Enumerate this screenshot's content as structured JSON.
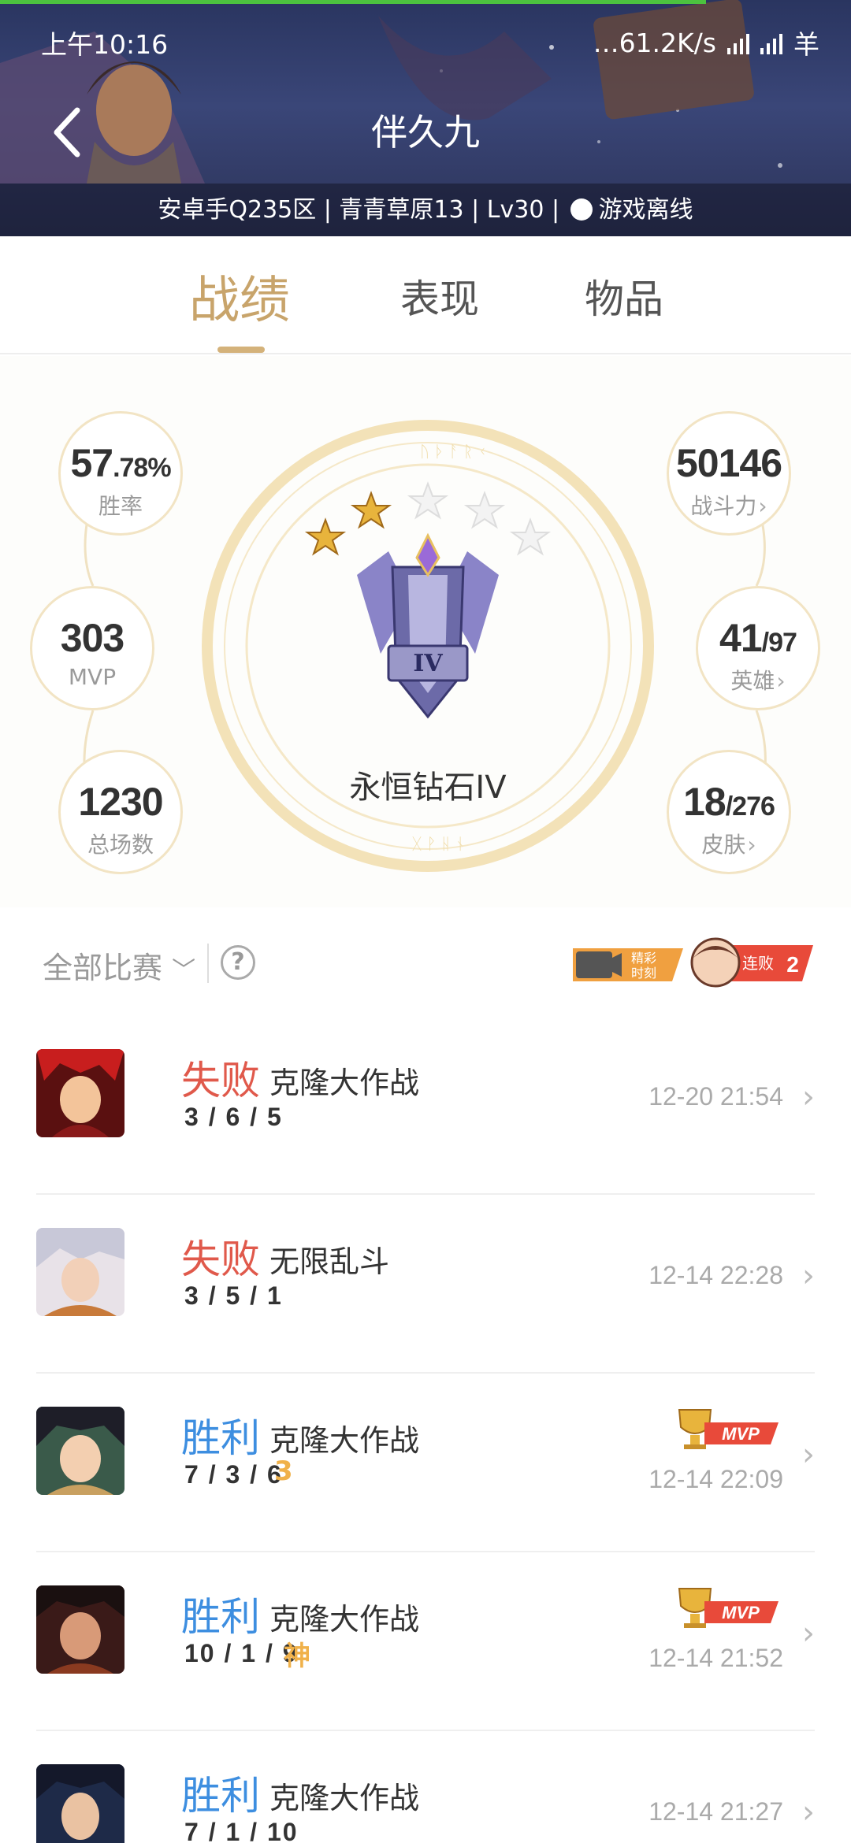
{
  "status_bar": {
    "time": "上午10:16",
    "net_speed": "61.2K/s",
    "extra_icon": "羊"
  },
  "header": {
    "title": "伴久九",
    "subtitle_prefix": "安卓手Q235区 | 青青草原13 | Lv30 |",
    "subtitle_status": "游戏离线",
    "back_icon": "chevron-left-icon"
  },
  "tabs": [
    {
      "label": "战绩",
      "active": true
    },
    {
      "label": "表现",
      "active": false
    },
    {
      "label": "物品",
      "active": false
    }
  ],
  "stats": {
    "win_rate_main": "57",
    "win_rate_frac": ".78%",
    "win_rate_label": "胜率",
    "mvp": "303",
    "mvp_label": "MVP",
    "total_matches": "1230",
    "total_matches_label": "总场数",
    "power": "50146",
    "power_label": "战斗力",
    "heroes_owned": "41",
    "heroes_total": "/97",
    "heroes_label": "英雄",
    "skins_owned": "18",
    "skins_total": "/276",
    "skins_label": "皮肤"
  },
  "rank": {
    "name": "永恒钻石IV",
    "tier_numeral": "IV",
    "stars_filled": 2,
    "stars_total": 5
  },
  "filter": {
    "selected": "全部比赛",
    "highlight_badge": [
      "精彩",
      "时刻"
    ],
    "streak_label": "连败",
    "streak_count": "2"
  },
  "matches": [
    {
      "result": "失败",
      "outcome": "lose",
      "mode": "克隆大作战",
      "kda": "3 / 6 / 5",
      "badge": "",
      "mvp": false,
      "datetime": "12-20 21:54"
    },
    {
      "result": "失败",
      "outcome": "lose",
      "mode": "无限乱斗",
      "kda": "3 / 5 / 1",
      "badge": "",
      "mvp": false,
      "datetime": "12-14 22:28"
    },
    {
      "result": "胜利",
      "outcome": "win",
      "mode": "克隆大作战",
      "kda": "7 / 3 / 6",
      "badge": "3",
      "mvp": true,
      "datetime": "12-14 22:09"
    },
    {
      "result": "胜利",
      "outcome": "win",
      "mode": "克隆大作战",
      "kda": "10 / 1 / 9",
      "badge": "神",
      "mvp": true,
      "datetime": "12-14 21:52"
    },
    {
      "result": "胜利",
      "outcome": "win",
      "mode": "克隆大作战",
      "kda": "7 / 1 / 10",
      "badge": "",
      "mvp": false,
      "datetime": "12-14 21:27"
    }
  ],
  "mvp_label": "MVP",
  "colors": {
    "gold": "#c8a46b",
    "lose": "#e0594b",
    "win": "#3d8ee0"
  }
}
